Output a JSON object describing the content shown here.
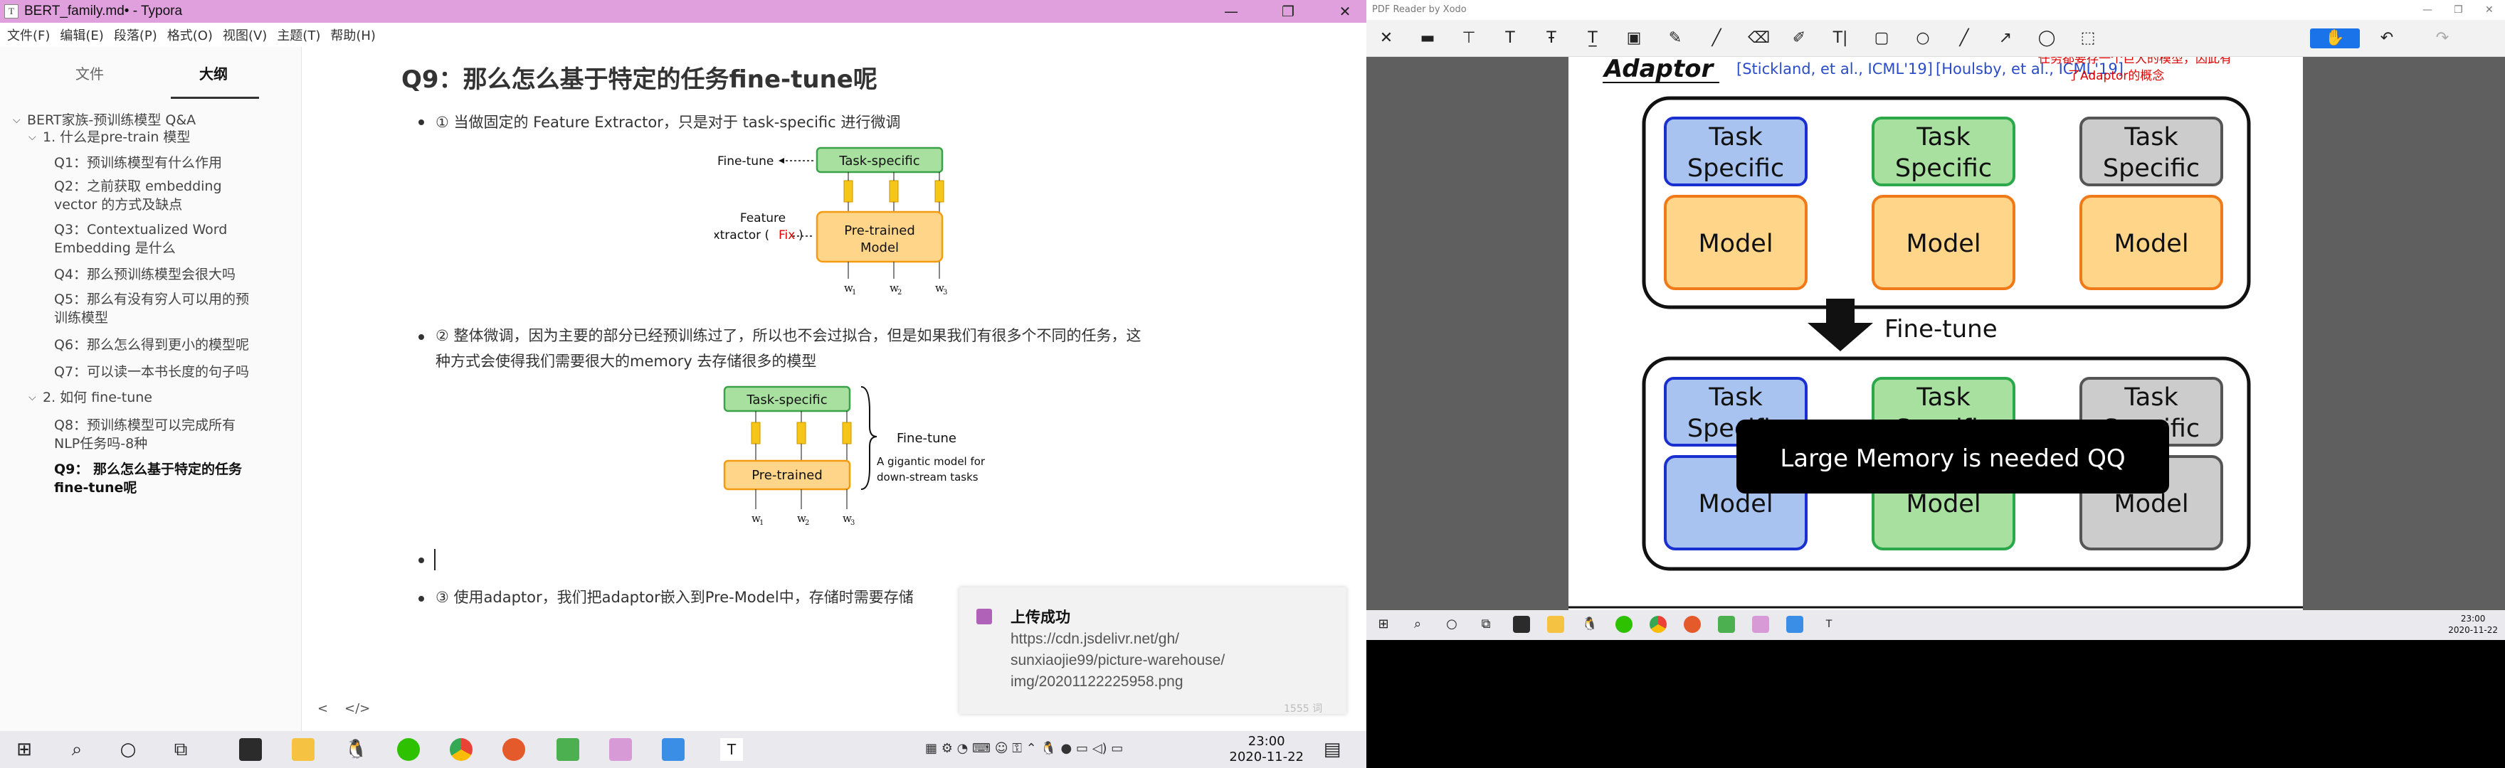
{
  "typora": {
    "title": "BERT_family.md• - Typora",
    "menu": [
      "文件(F)",
      "编辑(E)",
      "段落(P)",
      "格式(O)",
      "视图(V)",
      "主题(T)",
      "帮助(H)"
    ],
    "sidebar": {
      "tabs": [
        "文件",
        "大纲"
      ],
      "outline": [
        {
          "label": "BERT家族-预训练模型 Q&A"
        },
        {
          "label": "1. 什么是pre-train 模型"
        },
        {
          "label": "Q1：预训练模型有什么作用"
        },
        {
          "label": "Q2：之前获取 embedding"
        },
        {
          "label": "vector 的方式及缺点"
        },
        {
          "label": "Q3：Contextualized Word"
        },
        {
          "label": "Embedding 是什么"
        },
        {
          "label": "Q4：那么预训练模型会很大吗"
        },
        {
          "label": "Q5：那么有没有穷人可以用的预"
        },
        {
          "label": "训练模型"
        },
        {
          "label": "Q6：那么怎么得到更小的模型呢"
        },
        {
          "label": "Q7：可以读一本书长度的句子吗"
        },
        {
          "label": "2. 如何 fine-tune"
        },
        {
          "label": "Q8：预训练模型可以完成所有"
        },
        {
          "label": "NLP任务吗-8种"
        },
        {
          "label": "Q9：  那么怎么基于特定的任务"
        },
        {
          "label": "fine-tune呢"
        }
      ]
    },
    "heading": "Q9：那么怎么基于特定的任务fine-tune呢",
    "para1": "① 当做固定的 Feature Extractor，只是对于 task-specific 进行微调",
    "para2a": "② 整体微调，因为主要的部分已经预训练过了，所以也不会过拟合，但是如果我们有很多个不同的任务，这",
    "para2b": "种方式会使得我们需要很大的memory 去存储很多的模型",
    "para3": "③ 使用adaptor，我们把adaptor嵌入到Pre-Model中，存储时需要存储",
    "fig1": {
      "finetune": "Fine-tune",
      "task": "Task-specific",
      "feature": "Feature",
      "extractor": "Extractor (",
      "fix": "Fix",
      "close": ")",
      "pretrained1": "Pre-trained",
      "pretrained2": "Model",
      "w1": "w",
      "w2": "w",
      "w3": "w",
      "s1": "1",
      "s2": "2",
      "s3": "3"
    },
    "fig2": {
      "task": "Task-specific",
      "pretrained": "Pre-trained",
      "finetune": "Fine-tune",
      "gigantic1": "A gigantic model for",
      "gigantic2": "down-stream tasks",
      "w": "w",
      "s1": "1",
      "s2": "2",
      "s3": "3"
    },
    "toast": {
      "title": "上传成功",
      "line1": "https://cdn.jsdelivr.net/gh/",
      "line2": "sunxiaojie99/picture-warehouse/",
      "line3": "img/20201122225958.png"
    },
    "status": {
      "left_arrow": "<",
      "source_toggle": "</>",
      "wordcount": "1555 词"
    },
    "clock": {
      "time": "23:00",
      "date": "2020-11-22"
    }
  },
  "pdf": {
    "title": "PDF Reader by Xodo",
    "slide": {
      "title": "Adaptor",
      "cite1": "[Stickland, et al., ICML'19]",
      "cite2": "[Houlsby, et al., ICML'19]",
      "note1": "任务都要存一个巨大的模型，因此有",
      "note2": "了Adaptor的概念",
      "task": "Task",
      "specific": "Specific",
      "model": "Model",
      "finetune": "Fine-tune",
      "memory": "Large Memory is needed QQ"
    },
    "clock": {
      "time": "23:00",
      "date": "2020-11-22"
    }
  },
  "colors": {
    "typora_titlebar": "#e0a0de",
    "task_blue": "#a9c3f0",
    "task_green": "#a8e0a0",
    "task_gray": "#cccccc",
    "model_orange": "#ffd58a",
    "pdf_select": "#1a73e8"
  }
}
